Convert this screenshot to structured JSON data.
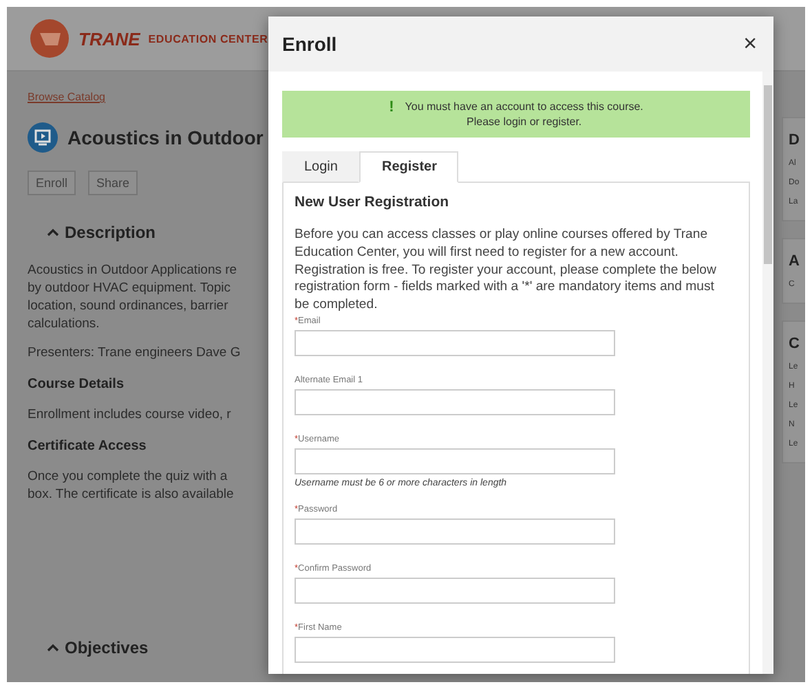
{
  "header": {
    "brand": "TRANE",
    "subtitle": "EDUCATION CENTER"
  },
  "page": {
    "breadcrumb": "Browse Catalog",
    "title": "Acoustics in Outdoor",
    "actions": [
      "Enroll",
      "Share"
    ],
    "sections": [
      {
        "kind": "heading",
        "text": "Description",
        "expanded": true
      },
      {
        "kind": "lines",
        "lines": [
          "Acoustics in Outdoor Applications re",
          "by outdoor HVAC equipment. Topic",
          "location, sound ordinances, barrier",
          "calculations."
        ]
      },
      {
        "kind": "lines",
        "lines": [
          "Presenters: Trane engineers Dave G"
        ]
      },
      {
        "kind": "subheading",
        "text": "Course Details"
      },
      {
        "kind": "lines",
        "lines": [
          "Enrollment includes course video, r"
        ]
      },
      {
        "kind": "subheading",
        "text": "Certificate Access"
      },
      {
        "kind": "lines",
        "lines": [
          "Once you complete the quiz with a",
          "box. The certificate is also available"
        ]
      }
    ],
    "footer_heading": {
      "text": "Objectives",
      "expanded": true
    }
  },
  "side": [
    {
      "title": "D",
      "lines": [
        "Al",
        "Do",
        "La"
      ]
    },
    {
      "title": "A",
      "lines": [
        "C"
      ]
    },
    {
      "title": "C",
      "lines": [
        "Le",
        "H",
        "Le",
        "N",
        "Le"
      ]
    }
  ],
  "modal": {
    "title": "Enroll",
    "close": "×",
    "alert": {
      "icon": "!",
      "lines": [
        "You must have an account to access this course.",
        "Please login or register."
      ]
    },
    "tabs": [
      {
        "label": "Login",
        "selected": false
      },
      {
        "label": "Register",
        "selected": true
      }
    ],
    "heading": "New User Registration",
    "intro": "Before you can access classes or play online courses offered by Trane Education Center, you will first need to register for a new account. Registration is free. To register your account, please complete the below registration form - fields marked with a '*' are mandatory items and must be completed.",
    "fields": [
      {
        "label": "Email",
        "mark": "*"
      },
      {
        "label": "Alternate Email 1"
      },
      {
        "label": "Username",
        "mark": "*",
        "hint": "Username must be 6 or more characters in length"
      },
      {
        "label": "Password",
        "mark": "*"
      },
      {
        "label": "Confirm Password",
        "mark": "*"
      },
      {
        "label": "First Name",
        "mark": "*"
      }
    ]
  }
}
